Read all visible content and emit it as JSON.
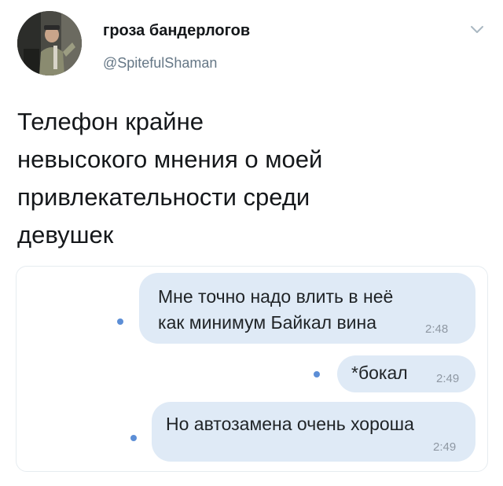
{
  "author": {
    "name": "гроза бандерлогов",
    "handle": "@SpitefulShaman"
  },
  "tweet": {
    "text_lines": [
      "Телефон крайне",
      "невысокого мнения о моей",
      "привлекательности среди",
      "девушек"
    ]
  },
  "conversation": {
    "messages": [
      {
        "lines": [
          "Мне точно надо влить в неё",
          "как минимум Байкал вина"
        ],
        "time": "2:48"
      },
      {
        "lines": [
          "*бокал"
        ],
        "time": "2:49"
      },
      {
        "lines": [
          "Но автозамена очень хороша"
        ],
        "time": "2:49"
      }
    ]
  },
  "colors": {
    "bubble": "#dfeaf6",
    "unread_dot": "#5c8ed6",
    "handle": "#657786"
  },
  "icons": {
    "menu": "chevron-down-icon",
    "avatar": "avatar"
  }
}
